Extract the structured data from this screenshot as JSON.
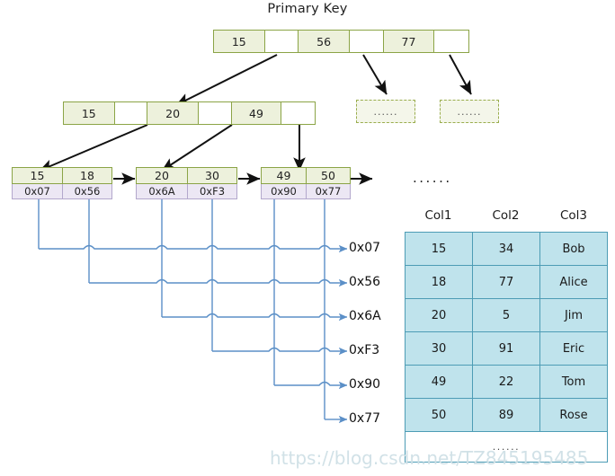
{
  "title": "Primary Key",
  "root_node": {
    "name": "root-node",
    "cells": [
      {
        "type": "key",
        "value": "15"
      },
      {
        "type": "pointer",
        "value": ""
      },
      {
        "type": "key",
        "value": "56"
      },
      {
        "type": "pointer",
        "value": ""
      },
      {
        "type": "key",
        "value": "77"
      },
      {
        "type": "pointer",
        "value": ""
      }
    ]
  },
  "internal_node": {
    "name": "internal-node",
    "cells": [
      {
        "type": "key",
        "value": "15"
      },
      {
        "type": "pointer",
        "value": ""
      },
      {
        "type": "key",
        "value": "20"
      },
      {
        "type": "pointer",
        "value": ""
      },
      {
        "type": "key",
        "value": "49"
      },
      {
        "type": "pointer",
        "value": ""
      }
    ]
  },
  "placeholder_nodes": [
    {
      "label": "......"
    },
    {
      "label": "......"
    }
  ],
  "leaf_nodes": [
    {
      "keys": [
        "15",
        "18"
      ],
      "addresses": [
        "0x07",
        "0x56"
      ]
    },
    {
      "keys": [
        "20",
        "30"
      ],
      "addresses": [
        "0x6A",
        "0xF3"
      ]
    },
    {
      "keys": [
        "49",
        "50"
      ],
      "addresses": [
        "0x90",
        "0x77"
      ]
    }
  ],
  "address_labels": [
    "0x07",
    "0x56",
    "0x6A",
    "0xF3",
    "0x90",
    "0x77"
  ],
  "table_ellipsis": "......",
  "data_table": {
    "columns": [
      "Col1",
      "Col2",
      "Col3"
    ],
    "rows": [
      [
        "15",
        "34",
        "Bob"
      ],
      [
        "18",
        "77",
        "Alice"
      ],
      [
        "20",
        "5",
        "Jim"
      ],
      [
        "30",
        "91",
        "Eric"
      ],
      [
        "49",
        "22",
        "Tom"
      ],
      [
        "50",
        "89",
        "Rose"
      ]
    ],
    "trailing_row": "......"
  },
  "watermark": "https://blog.csdn.net/TZ845195485",
  "colors": {
    "key_fill": "#edf1dc",
    "key_border": "#8ba446",
    "address_fill": "#ece7f4",
    "address_border": "#b3a8cc",
    "table_fill": "#bfe3ec",
    "table_border": "#4d9cb5",
    "link_line": "#5b8fc7",
    "arrow_black": "#111111"
  }
}
